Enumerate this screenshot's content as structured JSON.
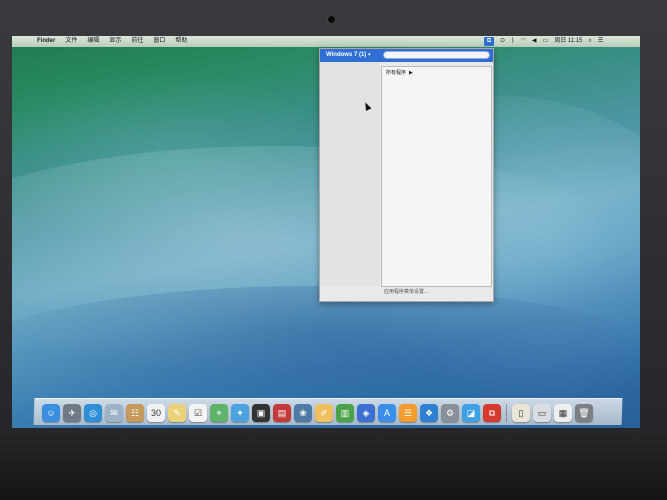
{
  "menubar": {
    "apple": "",
    "items": [
      "Finder",
      "文件",
      "编辑",
      "显示",
      "前往",
      "窗口",
      "帮助"
    ],
    "status": {
      "wifi_icon": "wifi-icon",
      "volume_icon": "volume-icon",
      "time": "周日 11:15",
      "search_icon": "search-icon",
      "list_icon": "list-icon"
    }
  },
  "popup": {
    "title": "Windows 7 (1)",
    "caret": "▾",
    "search_placeholder": "",
    "all_programs": "所有程序",
    "all_programs_arrow": "▶",
    "footer": "应用程序菜单设置..."
  },
  "dock": {
    "icons": [
      {
        "name": "finder-icon",
        "glyph": "☺",
        "color": "#3b8fe0"
      },
      {
        "name": "launchpad-icon",
        "glyph": "✈",
        "color": "#6f7a86"
      },
      {
        "name": "safari-icon",
        "glyph": "◎",
        "color": "#2f8fd6"
      },
      {
        "name": "mail-icon",
        "glyph": "✉",
        "color": "#9fb3c8"
      },
      {
        "name": "contacts-icon",
        "glyph": "☷",
        "color": "#c69a5a"
      },
      {
        "name": "calendar-icon",
        "glyph": "30",
        "color": "#f2f2f2"
      },
      {
        "name": "notes-icon",
        "glyph": "✎",
        "color": "#e9d27a"
      },
      {
        "name": "reminders-icon",
        "glyph": "☑",
        "color": "#f4f4f4"
      },
      {
        "name": "maps-icon",
        "glyph": "⌖",
        "color": "#5fb36a"
      },
      {
        "name": "messages-icon",
        "glyph": "✦",
        "color": "#4da3e0"
      },
      {
        "name": "facetime-icon",
        "glyph": "▣",
        "color": "#333333"
      },
      {
        "name": "photo-booth-icon",
        "glyph": "▤",
        "color": "#c23a3a"
      },
      {
        "name": "iphoto-icon",
        "glyph": "❀",
        "color": "#4f7aa5"
      },
      {
        "name": "pages-icon",
        "glyph": "✐",
        "color": "#f0c060"
      },
      {
        "name": "numbers-icon",
        "glyph": "▥",
        "color": "#4aa34a"
      },
      {
        "name": "keynote-icon",
        "glyph": "◈",
        "color": "#3c6fd0"
      },
      {
        "name": "app-store-icon",
        "glyph": "A",
        "color": "#3a8ee8"
      },
      {
        "name": "ibooks-icon",
        "glyph": "☰",
        "color": "#f39b2c"
      },
      {
        "name": "windows-icon",
        "glyph": "❖",
        "color": "#2f7fd2"
      },
      {
        "name": "system-preferences-icon",
        "glyph": "⚙",
        "color": "#8a9099"
      },
      {
        "name": "boot-camp-icon",
        "glyph": "◪",
        "color": "#3ea0e5"
      },
      {
        "name": "parallels-icon",
        "glyph": "⧉",
        "color": "#d63b32"
      }
    ],
    "right_icons": [
      {
        "name": "document-icon",
        "glyph": "▯",
        "color": "#e8e4d8"
      },
      {
        "name": "folder-icon",
        "glyph": "▭",
        "color": "#d8dde3"
      },
      {
        "name": "stack-icon",
        "glyph": "▦",
        "color": "#eeeeee"
      },
      {
        "name": "trash-icon",
        "glyph": "🗑",
        "color": "#7a7f86"
      }
    ]
  }
}
